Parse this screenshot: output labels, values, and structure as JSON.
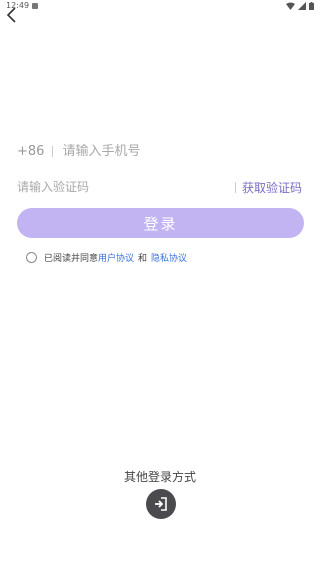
{
  "status_bar": {
    "time": "12:49"
  },
  "login": {
    "country_code": "+86",
    "phone_placeholder": "请输入手机号",
    "code_placeholder": "请输入验证码",
    "get_code_label": "获取验证码",
    "login_button_label": "登录"
  },
  "agreement": {
    "prefix": "已阅读并同意",
    "user_agreement": "用户协议",
    "and": "和",
    "privacy_policy": "隐私协议"
  },
  "other_login": {
    "title": "其他登录方式",
    "icon": "login-arrow-icon"
  },
  "colors": {
    "button": "#c2b4f3",
    "accent": "#7c6cc4",
    "link": "#3a6fd8",
    "icon_bg": "#4a4a4f"
  }
}
